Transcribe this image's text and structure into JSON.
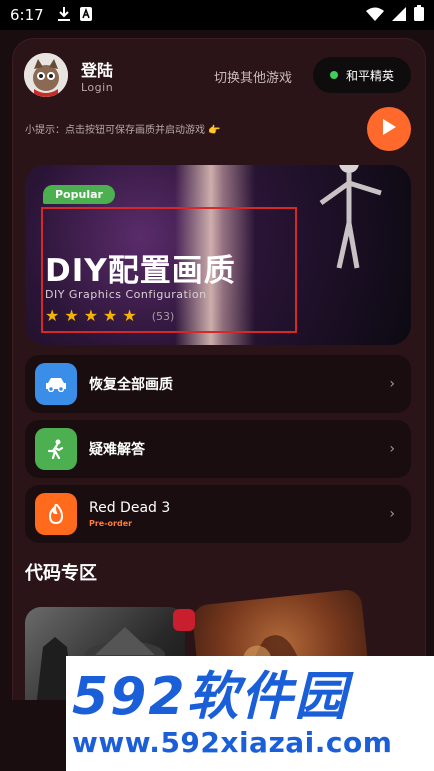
{
  "status_bar": {
    "time": "6:17",
    "left_icons": [
      "download-icon",
      "a-letter-icon"
    ],
    "right_icons": [
      "wifi-icon",
      "signal-icon",
      "battery-icon"
    ]
  },
  "header": {
    "login_title": "登陆",
    "login_subtitle": "Login",
    "switch_games_label": "切换其他游戏",
    "current_game": "和平精英"
  },
  "tip": {
    "text": "小提示：点击按钮可保存画质并启动游戏 👉",
    "play_icon": "play-icon"
  },
  "banner": {
    "badge": "Popular",
    "title": "DIY配置画质",
    "subtitle": "DIY Graphics Configuration",
    "rating_stars": 5,
    "rating_count": "(53)"
  },
  "menu": {
    "items": [
      {
        "label": "恢复全部画质",
        "icon": "car-icon",
        "color": "#3a8ee8"
      },
      {
        "label": "疑难解答",
        "icon": "running-person-icon",
        "color": "#4caf50"
      },
      {
        "label": "Red Dead 3",
        "sublabel": "Pre-order",
        "icon": "flame-icon",
        "color": "#ff6a1c"
      }
    ]
  },
  "code_section": {
    "title": "代码专区"
  },
  "watermark": {
    "logo": "592软件园",
    "url": "www.592xiazai.com"
  },
  "colors": {
    "accent_orange": "#ff6a2c",
    "popular_green": "#4caf50",
    "star_yellow": "#f4b400",
    "card_bg": "#1a0d0f",
    "frame_bg": "#2a1418",
    "watermark_blue": "#1a5ed8"
  }
}
